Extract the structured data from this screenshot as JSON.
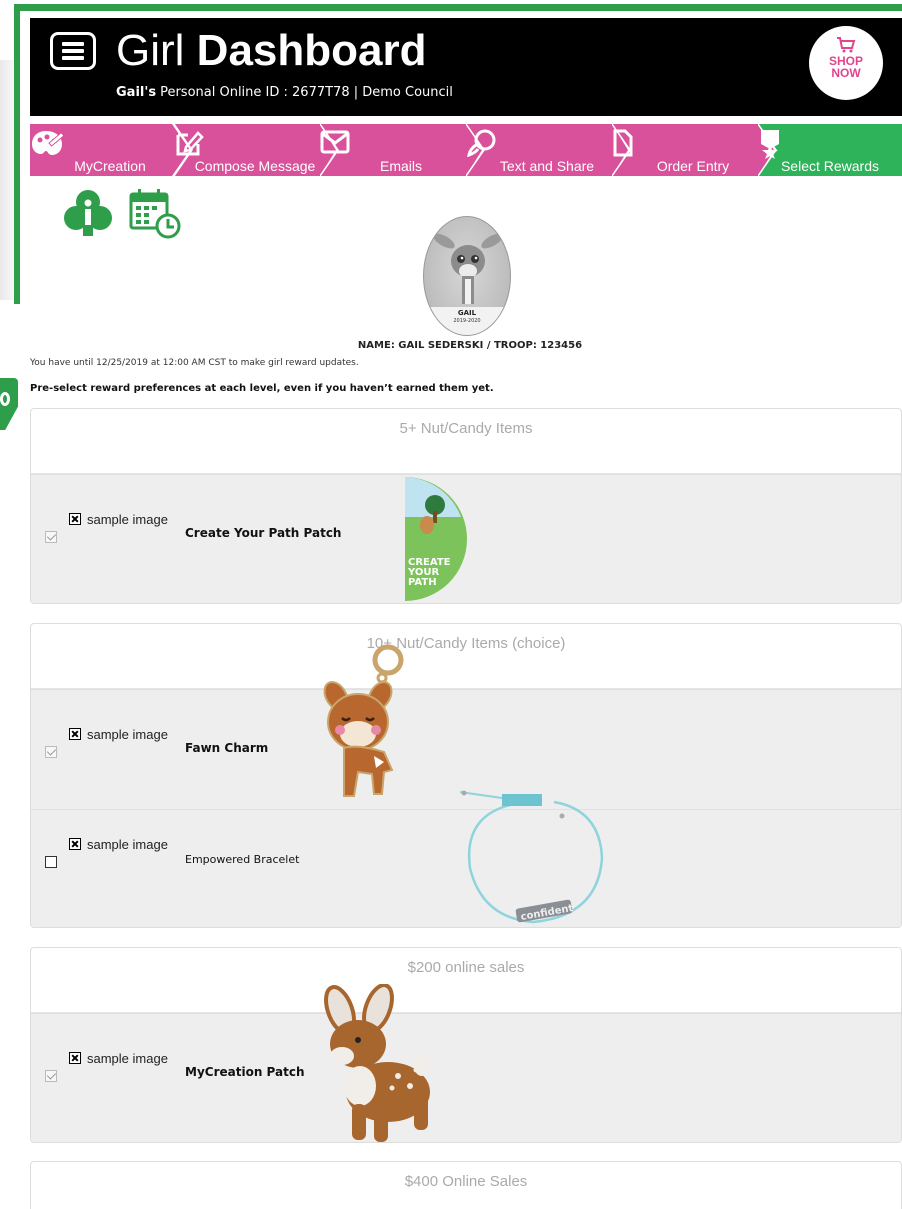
{
  "header": {
    "title_light": "Girl",
    "title_bold": "Dashboard",
    "girl_name": "Gail's",
    "sub_text": "Personal Online ID : 2677T78 | Demo Council",
    "shop_line1": "SHOP",
    "shop_line2": "NOW"
  },
  "steps": [
    {
      "label": "MyCreation",
      "icon": "palette-icon"
    },
    {
      "label": "Compose Message",
      "icon": "pencil-square-icon"
    },
    {
      "label": "Emails",
      "icon": "envelope-icon"
    },
    {
      "label": "Text and Share",
      "icon": "chat-bubbles-icon"
    },
    {
      "label": "Order Entry",
      "icon": "document-icon"
    },
    {
      "label": "Select Rewards",
      "icon": "award-ribbon-icon"
    }
  ],
  "colors": {
    "step_pink": "#d9519a",
    "step_active": "#2eb25a",
    "brand_green": "#2e9e4a"
  },
  "avatar": {
    "name": "GAIL",
    "year": "2019-2020"
  },
  "name_line": "NAME: GAIL SEDERSKI / TROOP: 123456",
  "deadline_text": "You have until 12/25/2019 at 12:00 AM CST to make girl reward updates.",
  "preselect_text": "Pre-select reward preferences at each level, even if you haven’t earned them yet.",
  "sample_label": "sample image",
  "rewards": [
    {
      "level": "5+ Nut/Candy Items",
      "items": [
        {
          "name": "Create Your Path Patch",
          "checked": true,
          "disabled": true
        }
      ]
    },
    {
      "level": "10+ Nut/Candy Items (choice)",
      "items": [
        {
          "name": "Fawn Charm",
          "checked": true,
          "disabled": false
        },
        {
          "name": "Empowered Bracelet",
          "checked": false,
          "disabled": false
        }
      ]
    },
    {
      "level": "$200 online sales",
      "items": [
        {
          "name": "MyCreation Patch",
          "checked": true,
          "disabled": true
        }
      ]
    },
    {
      "level": "$400 Online Sales",
      "items": []
    }
  ],
  "patch_text": "CREATE YOUR PATH",
  "bracelet_text": "confident"
}
